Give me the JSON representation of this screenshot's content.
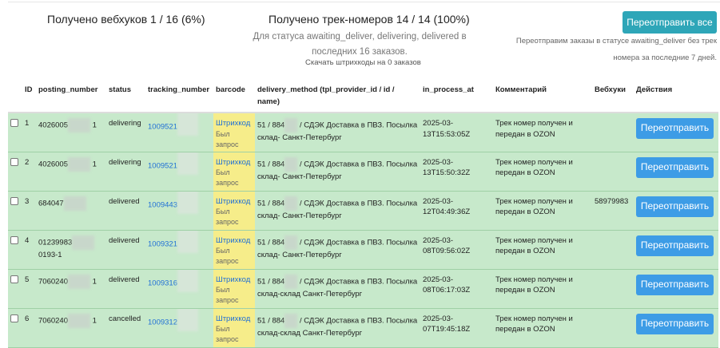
{
  "header": {
    "webhooks_received": "Получено вебхуков 1 / 16 (6%)",
    "tracks_received": "Получено трек-номеров 14 / 14 (100%)",
    "tracks_sub_line1": "Для статуса awaiting_deliver, delivering, delivered в",
    "tracks_sub_line2": "последних 16 заказов.",
    "download_barcodes": "Скачать штрихкоды на 0 заказов",
    "resend_all_label": "Переотправить все",
    "resend_note_line1": "Переотправим заказы в статусе awaiting_deliver без трек",
    "resend_note_line2": "номера за последние 7 дней."
  },
  "columns": [
    "ID",
    "posting_number",
    "status",
    "tracking_number",
    "barcode",
    "delivery_method (tpl_provider_id / id / name)",
    "in_process_at",
    "Комментарий",
    "Вебхуки",
    "Действия"
  ],
  "rows": [
    {
      "id": "1",
      "posting_a": "4026005",
      "posting_b": "1",
      "posting_c": "",
      "status": "delivering",
      "tracking": "1009521",
      "barcode_link": "Штрихкод",
      "barcode_note1": "Был",
      "barcode_note2": "запрос",
      "delivery_a": "51 / 884",
      "delivery_b": "/ СДЭК Доставка в ПВЗ. Посылка",
      "delivery_c": "склад-",
      "delivery_d": "Санкт-Петербург",
      "date_a": "2025-03-",
      "date_b": "13T15:53:05Z",
      "comment_a": "Трек номер получен и",
      "comment_b": "передан в OZON",
      "webhooks": "",
      "action": "Переотправить"
    },
    {
      "id": "2",
      "posting_a": "4026005",
      "posting_b": "1",
      "posting_c": "",
      "status": "delivering",
      "tracking": "1009521",
      "barcode_link": "Штрихкод",
      "barcode_note1": "Был",
      "barcode_note2": "запрос",
      "delivery_a": "51 / 884",
      "delivery_b": "/ СДЭК Доставка в ПВЗ. Посылка",
      "delivery_c": "склад-",
      "delivery_d": "Санкт-Петербург",
      "date_a": "2025-03-",
      "date_b": "13T15:50:32Z",
      "comment_a": "Трек номер получен и",
      "comment_b": "передан в OZON",
      "webhooks": "",
      "action": "Переотправить"
    },
    {
      "id": "3",
      "posting_a": "684047",
      "posting_b": "",
      "posting_c": "",
      "status": "delivered",
      "tracking": "1009443",
      "barcode_link": "Штрихкод",
      "barcode_note1": "Был",
      "barcode_note2": "запрос",
      "delivery_a": "51 / 884",
      "delivery_b": "/ СДЭК Доставка в ПВЗ. Посылка",
      "delivery_c": "склад-",
      "delivery_d": "Санкт-Петербург",
      "date_a": "2025-03-",
      "date_b": "12T04:49:36Z",
      "comment_a": "Трек номер получен и",
      "comment_b": "передан в OZON",
      "webhooks": "58979983",
      "action": "Переотправить"
    },
    {
      "id": "4",
      "posting_a": "01239983",
      "posting_b": "",
      "posting_c": "0193-1",
      "status": "delivered",
      "tracking": "1009321",
      "barcode_link": "Штрихкод",
      "barcode_note1": "Был",
      "barcode_note2": "запрос",
      "delivery_a": "51 / 884",
      "delivery_b": "/ СДЭК Доставка в ПВЗ. Посылка",
      "delivery_c": "склад-",
      "delivery_d": "Санкт-Петербург",
      "date_a": "2025-03-",
      "date_b": "08T09:56:02Z",
      "comment_a": "Трек номер получен и",
      "comment_b": "передан в OZON",
      "webhooks": "",
      "action": "Переотправить"
    },
    {
      "id": "5",
      "posting_a": "7060240",
      "posting_b": "1",
      "posting_c": "",
      "status": "delivered",
      "tracking": "1009316",
      "barcode_link": "Штрихкод",
      "barcode_note1": "Был",
      "barcode_note2": "запрос",
      "delivery_a": "51 / 884",
      "delivery_b": "/ СДЭК Доставка в ПВЗ. Посылка",
      "delivery_c": "склад-склад",
      "delivery_d": "Санкт-Петербург",
      "date_a": "2025-03-",
      "date_b": "08T06:17:03Z",
      "comment_a": "Трек номер получен и",
      "comment_b": "передан в OZON",
      "webhooks": "",
      "action": "Переотправить"
    },
    {
      "id": "6",
      "posting_a": "7060240",
      "posting_b": "1",
      "posting_c": "",
      "status": "cancelled",
      "tracking": "1009312",
      "barcode_link": "Штрихкод",
      "barcode_note1": "Был",
      "barcode_note2": "запрос",
      "delivery_a": "51 / 884",
      "delivery_b": "/ СДЭК Доставка в ПВЗ. Посылка",
      "delivery_c": "склад-склад",
      "delivery_d": "Санкт-Петербург",
      "date_a": "2025-03-",
      "date_b": "07T19:45:18Z",
      "comment_a": "Трек номер получен и",
      "comment_b": "передан в OZON",
      "webhooks": "",
      "action": "Переотправить"
    }
  ]
}
